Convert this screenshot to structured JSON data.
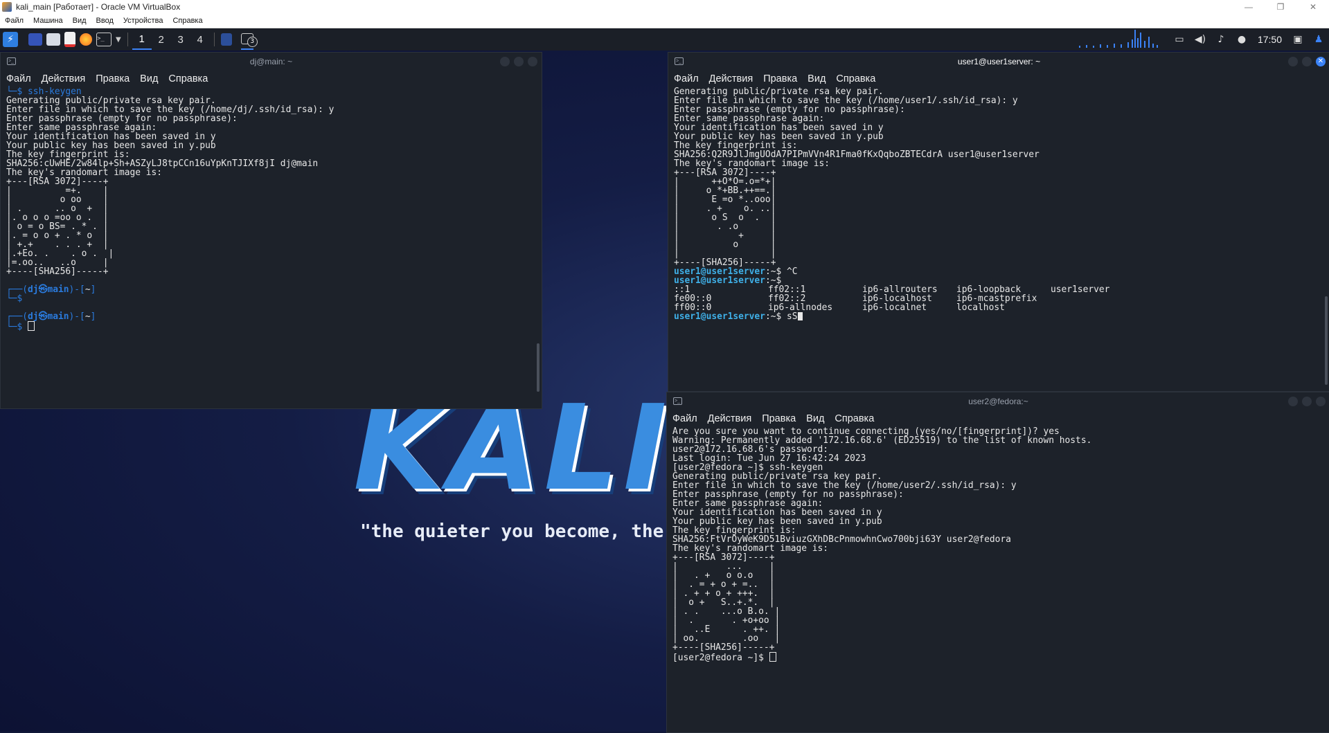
{
  "host": {
    "title": "kali_main [Работает] - Oracle VM VirtualBox",
    "menu": [
      "Файл",
      "Машина",
      "Вид",
      "Ввод",
      "Устройства",
      "Справка"
    ],
    "controls": [
      "—",
      "❐",
      "✕"
    ]
  },
  "wallpaper": {
    "logo": "KALI L",
    "quote": "\"the quieter you become, the"
  },
  "panel": {
    "workspaces": [
      "1",
      "2",
      "3",
      "4"
    ],
    "active_workspace": "1",
    "badge": "3",
    "clock": "17:50",
    "icons": [
      "kali-menu-icon",
      "desktop-icon",
      "files-icon",
      "editor-icon",
      "firefox-icon",
      "terminal-icon",
      "screen-icon",
      "volume-icon",
      "bell-icon",
      "power-icon",
      "lock-icon",
      "user-icon"
    ]
  },
  "terminal_menu": [
    "Файл",
    "Действия",
    "Правка",
    "Вид",
    "Справка"
  ],
  "term1": {
    "title": "dj@main: ~",
    "lines": [
      "└─$ ssh-keygen",
      "Generating public/private rsa key pair.",
      "Enter file in which to save the key (/home/dj/.ssh/id_rsa): y",
      "Enter passphrase (empty for no passphrase):",
      "Enter same passphrase again:",
      "Your identification has been saved in y",
      "Your public key has been saved in y.pub",
      "The key fingerprint is:",
      "SHA256:cUwHE/2w84lp+Sh+ASZyLJ8tpCCn16uYpKnTJIXf8jI dj@main",
      "The key's randomart image is:",
      "+---[RSA 3072]----+",
      "|          =+.    |",
      "|         o oo    |",
      "| .      .. o  +  |",
      "|. o o o =oo o .  |",
      "| o = o BS= . * . |",
      "|. = o o + . * o  |",
      "| +.+    . . . +  |",
      "|.+Eo. .    . o .  |",
      "|=.oo..   ..o     |",
      "+----[SHA256]-----+"
    ],
    "prompt_user": "dj㉿main",
    "prompt_dir": "~"
  },
  "term2": {
    "title": "user1@user1server: ~",
    "lines": [
      "Generating public/private rsa key pair.",
      "Enter file in which to save the key (/home/user1/.ssh/id_rsa): y",
      "Enter passphrase (empty for no passphrase):",
      "Enter same passphrase again:",
      "Your identification has been saved in y",
      "Your public key has been saved in y.pub",
      "The key fingerprint is:",
      "SHA256:Q2R9JlJmgUOdA7PIPmVVn4R1Fma0fKxQqboZBTECdrA user1@user1server",
      "The key's randomart image is:",
      "+---[RSA 3072]----+",
      "|      ++O*O=.o=*+|",
      "|     o *+BB.++==.|",
      "|      E =o *..ooo|",
      "|     . +    o. ..|",
      "|      o S  o  .  |",
      "|       . .o      |",
      "|           +     |",
      "|          o      |",
      "|                 |",
      "+----[SHA256]-----+"
    ],
    "prompt": "user1@user1server",
    "prompt_tail": ":~$ ",
    "cmd1": "^C",
    "cmd3": "sS",
    "hosts": [
      [
        "::1",
        "ff02::1",
        "ip6-allrouters",
        "ip6-loopback",
        "user1server"
      ],
      [
        "fe00::0",
        "ff02::2",
        "ip6-localhost",
        "ip6-mcastprefix",
        ""
      ],
      [
        "ff00::0",
        "ip6-allnodes",
        "ip6-localnet",
        "localhost",
        ""
      ]
    ]
  },
  "term3": {
    "title": "user2@fedora:~",
    "lines": [
      "Are you sure you want to continue connecting (yes/no/[fingerprint])? yes",
      "Warning: Permanently added '172.16.68.6' (ED25519) to the list of known hosts.",
      "user2@172.16.68.6's password:",
      "Last login: Tue Jun 27 16:42:24 2023",
      "[user2@fedora ~]$ ssh-keygen",
      "Generating public/private rsa key pair.",
      "Enter file in which to save the key (/home/user2/.ssh/id_rsa): y",
      "Enter passphrase (empty for no passphrase):",
      "Enter same passphrase again:",
      "Your identification has been saved in y",
      "Your public key has been saved in y.pub",
      "The key fingerprint is:",
      "SHA256:FtVrOyWeK9D51BviuzGXhDBcPnmowhnCwo700bji63Y user2@fedora",
      "The key's randomart image is:",
      "+---[RSA 3072]----+",
      "|         ...     |",
      "|   . +   o o.o   |",
      "|  . = + o + =..  |",
      "| . + + o + +++.  |",
      "|  o +   S..+.*.  |",
      "| . .    ...o B.o. |",
      "|  .       . +o+oo |",
      "|   ..E      . ++. |",
      "| oo.        .oo   |",
      "+----[SHA256]-----+"
    ],
    "prompt": "[user2@fedora ~]$ "
  }
}
